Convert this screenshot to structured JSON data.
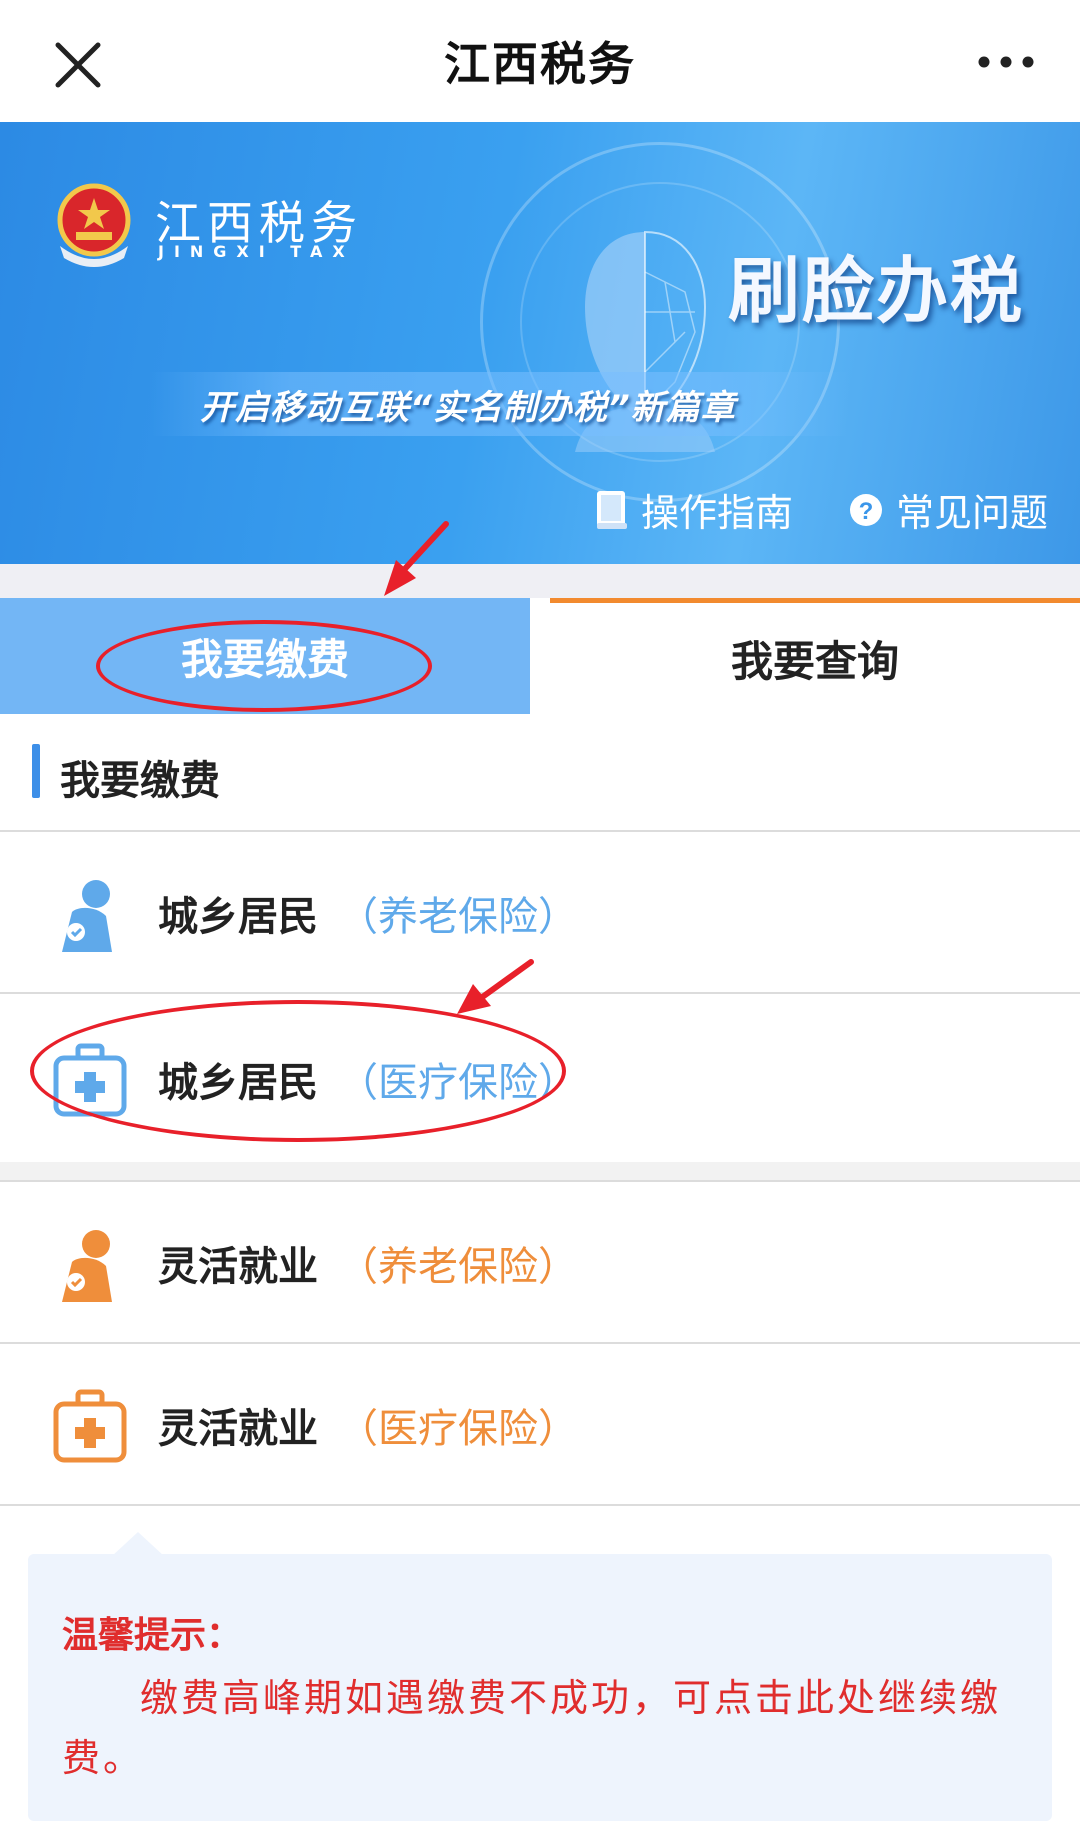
{
  "navbar": {
    "title": "江西税务",
    "close_icon": "close-icon",
    "more_icon": "more-icon"
  },
  "banner": {
    "logo_cn": "江西税务",
    "logo_en": "JINGXI TAX",
    "headline": "刷脸办税",
    "slogan": "开启移动互联“实名制办税”新篇章",
    "links": [
      {
        "label": "操作指南",
        "icon": "book-icon"
      },
      {
        "label": "常见问题",
        "icon": "question-icon"
      }
    ]
  },
  "tabs": [
    {
      "label": "我要缴费",
      "active": true
    },
    {
      "label": "我要查询",
      "active": false
    }
  ],
  "section": {
    "title": "我要缴费"
  },
  "items": [
    {
      "name": "城乡居民",
      "type": "（养老保险）",
      "color": "#5fa9ea",
      "icon": "elderly-person-icon"
    },
    {
      "name": "城乡居民",
      "type": "（医疗保险）",
      "color": "#5fa9ea",
      "icon": "medical-kit-icon"
    },
    {
      "name": "灵活就业",
      "type": "（养老保险）",
      "color": "#ef8e3b",
      "icon": "elderly-person-icon"
    },
    {
      "name": "灵活就业",
      "type": "（医疗保险）",
      "color": "#ef8e3b",
      "icon": "medical-kit-icon"
    }
  ],
  "tip": {
    "title": "温馨提示：",
    "body": "缴费高峰期如遇缴费不成功，可点击此处继续缴费。"
  },
  "colors": {
    "accent_blue": "#73b6f5",
    "accent_orange": "#f28a2f",
    "annotation_red": "#e8202a",
    "tip_red": "#e02d2d"
  }
}
